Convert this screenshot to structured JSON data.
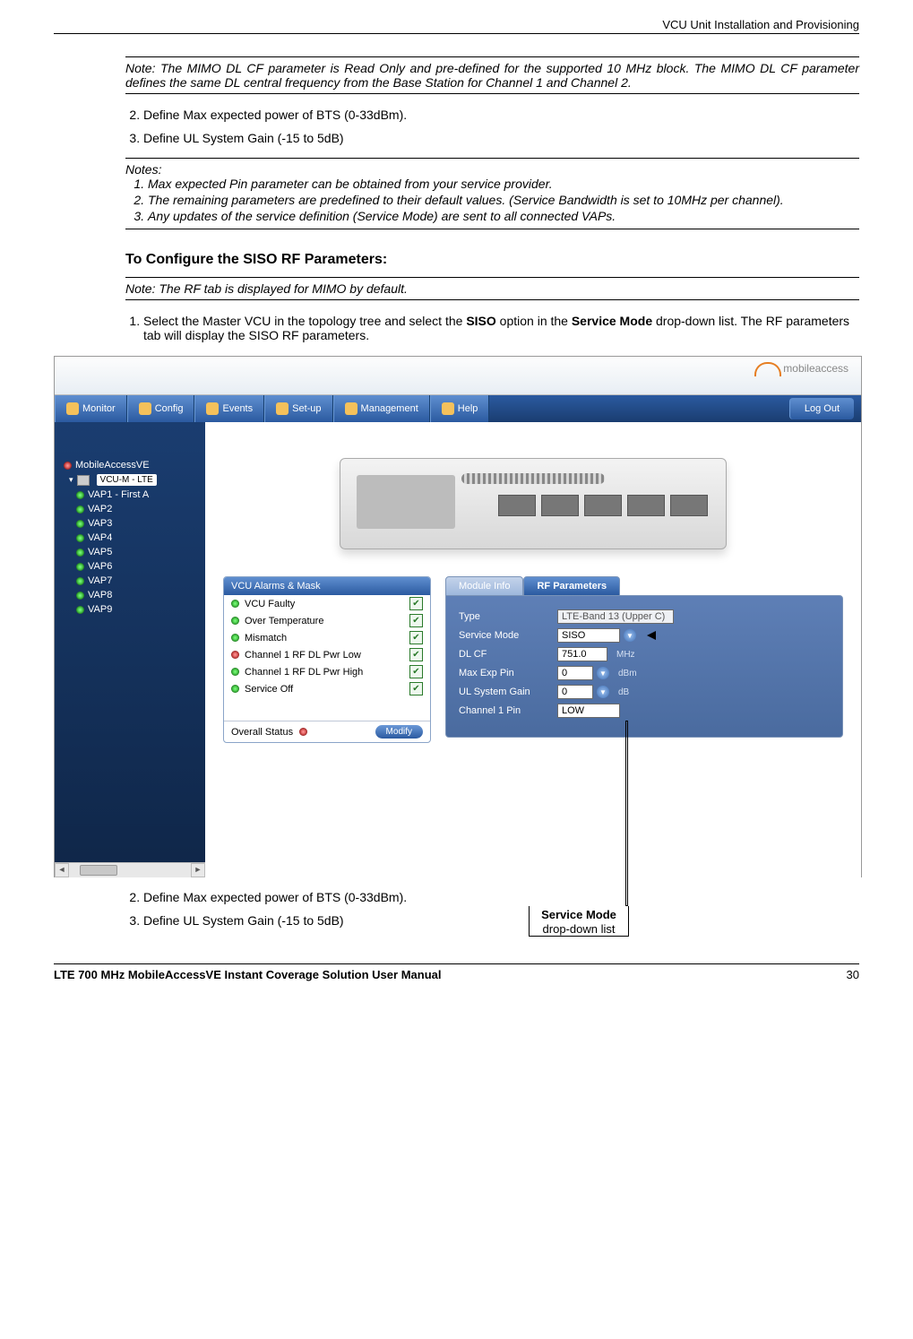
{
  "header": {
    "section_title": "VCU Unit Installation and Provisioning"
  },
  "note1": "Note: The MIMO DL CF parameter is Read Only and pre-defined for the supported 10 MHz block. The MIMO DL CF parameter defines the same DL central frequency from the Base Station for Channel 1 and Channel 2.",
  "steps_a": {
    "s2": "Define Max expected power of BTS (0-33dBm).",
    "s3": "Define UL System Gain (-15 to 5dB)"
  },
  "notes2": {
    "title": "Notes:",
    "n1": "Max expected Pin parameter can be obtained from your service provider.",
    "n2": "The remaining parameters are predefined to their default values. (Service Bandwidth is set to 10MHz per channel).",
    "n3": "Any updates of the service definition (Service Mode) are sent to all connected VAPs."
  },
  "h_siso": "To Configure the SISO RF Parameters:",
  "note3": "Note: The RF tab is displayed for MIMO by default.",
  "steps_b": {
    "s1_pre": "Select the Master VCU in the topology tree and select the ",
    "s1_bold1": "SISO",
    "s1_mid": " option in the ",
    "s1_bold2": "Service Mode",
    "s1_post": " drop-down list. The RF parameters tab will display the SISO RF parameters."
  },
  "app": {
    "logo": "mobileaccess",
    "nav": {
      "monitor": "Monitor",
      "config": "Config",
      "events": "Events",
      "setup": "Set-up",
      "management": "Management",
      "help": "Help",
      "logout": "Log Out"
    },
    "tree": {
      "root_led": "red",
      "root": "MobileAccessVE",
      "selected": "VCU-M - LTE",
      "items": [
        {
          "label": "VAP1 - First A",
          "led": "green"
        },
        {
          "label": "VAP2",
          "led": "green"
        },
        {
          "label": "VAP3",
          "led": "green"
        },
        {
          "label": "VAP4",
          "led": "green"
        },
        {
          "label": "VAP5",
          "led": "green"
        },
        {
          "label": "VAP6",
          "led": "green"
        },
        {
          "label": "VAP7",
          "led": "green"
        },
        {
          "label": "VAP8",
          "led": "green"
        },
        {
          "label": "VAP9",
          "led": "green"
        }
      ]
    },
    "alarms": {
      "title": "VCU Alarms & Mask",
      "rows": [
        {
          "led": "green",
          "label": "VCU Faulty",
          "checked": true
        },
        {
          "led": "green",
          "label": "Over Temperature",
          "checked": true
        },
        {
          "led": "green",
          "label": "Mismatch",
          "checked": true
        },
        {
          "led": "red",
          "label": "Channel 1 RF DL Pwr Low",
          "checked": true
        },
        {
          "led": "green",
          "label": "Channel 1 RF DL Pwr High",
          "checked": true
        },
        {
          "led": "green",
          "label": "Service Off",
          "checked": true
        }
      ],
      "overall_label": "Overall Status",
      "overall_led": "red",
      "modify": "Modify"
    },
    "rf": {
      "tab1": "Module Info",
      "tab2": "RF Parameters",
      "rows": {
        "type_label": "Type",
        "type_value": "LTE-Band 13 (Upper C)",
        "mode_label": "Service Mode",
        "mode_value": "SISO",
        "dlcf_label": "DL CF",
        "dlcf_value": "751.0",
        "dlcf_unit": "MHz",
        "pin_label": "Max Exp Pin",
        "pin_value": "0",
        "pin_unit": "dBm",
        "gain_label": "UL System Gain",
        "gain_value": "0",
        "gain_unit": "dB",
        "ch1_label": "Channel 1 Pin",
        "ch1_value": "LOW"
      }
    }
  },
  "callout": {
    "title": "Service Mode",
    "sub": "drop-down list"
  },
  "steps_c": {
    "s2": "Define Max expected power of BTS (0-33dBm).",
    "s3": "Define UL System Gain (-15 to 5dB)"
  },
  "footer": {
    "title": "LTE 700 MHz MobileAccessVE Instant Coverage Solution User Manual",
    "page": "30"
  }
}
